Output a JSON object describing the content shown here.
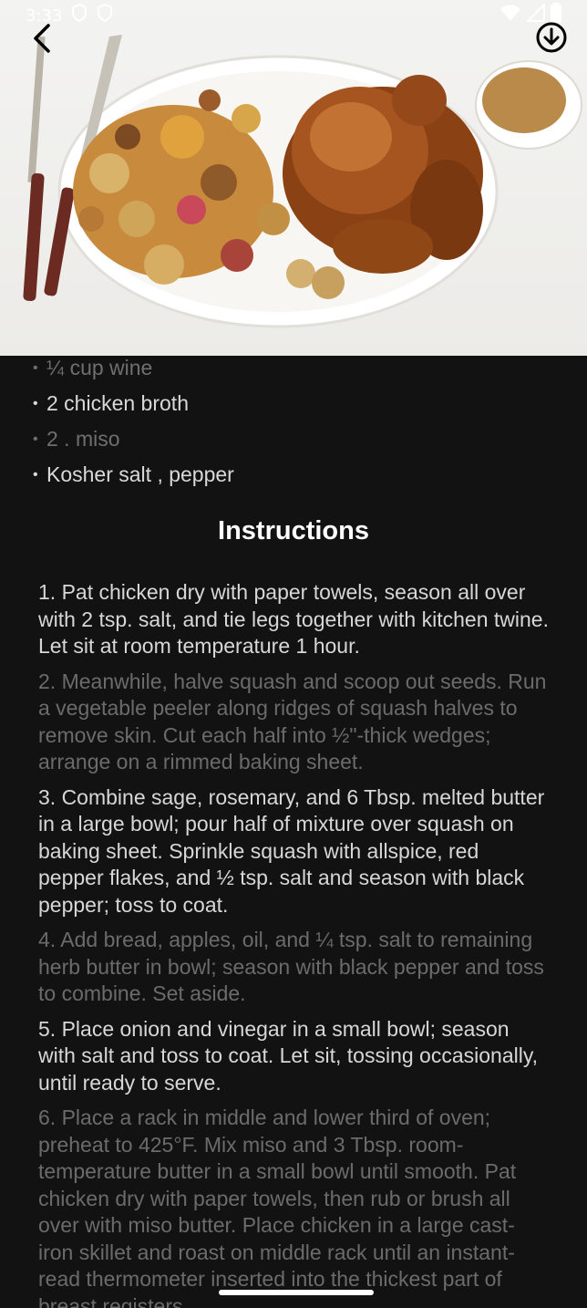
{
  "status_bar": {
    "time": "3:33",
    "icons": [
      "shield-icon",
      "shield-icon",
      "wifi-icon",
      "signal-icon",
      "battery-icon"
    ]
  },
  "app_bar": {
    "back_icon": "chevron-left-icon",
    "download_icon": "download-circle-icon"
  },
  "hero_image": {
    "subject": "roast-chicken-with-squash-and-bread-salad"
  },
  "ingredients": [
    {
      "text": "¼ cup wine",
      "style": "dim"
    },
    {
      "text": "2 chicken broth",
      "style": "bright"
    },
    {
      "text": "2 . miso",
      "style": "dim"
    },
    {
      "text": "Kosher salt , pepper",
      "style": "bright"
    }
  ],
  "instructions": {
    "title": "Instructions",
    "steps": [
      {
        "text": "1. Pat chicken dry with paper towels, season all over with 2 tsp. salt, and tie legs together with kitchen twine. Let sit at room temperature 1 hour.",
        "style": "bright"
      },
      {
        "text": "2. Meanwhile, halve squash and scoop out seeds. Run a vegetable peeler along ridges of squash halves to remove skin. Cut each half into ½\"-thick wedges; arrange on a rimmed baking sheet.",
        "style": "dim"
      },
      {
        "text": "3. Combine sage, rosemary, and 6 Tbsp. melted butter in a large bowl; pour half of mixture over squash on baking sheet. Sprinkle squash with allspice, red pepper flakes, and ½ tsp. salt and season with black pepper; toss to coat.",
        "style": "bright"
      },
      {
        "text": "4. Add bread, apples, oil, and ¼ tsp. salt to remaining herb butter in bowl; season with black pepper and toss to combine. Set aside.",
        "style": "dim"
      },
      {
        "text": "5. Place onion and vinegar in a small bowl; season with salt and toss to coat. Let sit, tossing occasionally, until ready to serve.",
        "style": "bright"
      },
      {
        "text": "6. Place a rack in middle and lower third of oven; preheat to 425°F. Mix miso and 3 Tbsp. room-temperature butter in a small bowl until smooth. Pat chicken dry with paper towels, then rub or brush all over with miso butter. Place chicken in a large cast-iron skillet and roast on middle rack until an instant-read thermometer inserted into the thickest part of breast registers",
        "style": "dim"
      }
    ]
  }
}
